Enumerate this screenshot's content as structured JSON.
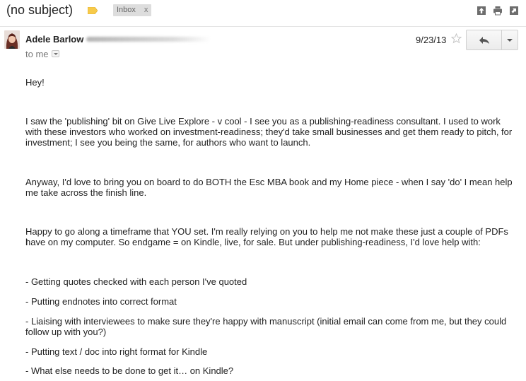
{
  "header": {
    "subject": "(no subject)",
    "label_chip": "Inbox",
    "label_chip_remove": "x",
    "icons": [
      "archive-icon",
      "print-icon",
      "new-window-icon"
    ],
    "label_tag_color": "#f7ca4a"
  },
  "message": {
    "sender_name": "Adele Barlow",
    "recipient_text": "to me",
    "date": "9/23/13"
  },
  "body": {
    "p1": "Hey!",
    "p2_line1": "I saw the 'publishing' bit on Give Live Explore - v cool - I see you as a publishing-readiness consultant. I used to work",
    "p2_line2": "with these investors who worked on investment-readiness; they'd take small businesses and get them ready to pitch, for",
    "p2_line3": "investment; I see you being the same, for authors who want to launch.",
    "p3_line1": "Anyway, I'd love to bring you on board to do BOTH the Esc MBA book and my Home piece - when I say 'do' I mean help",
    "p3_line2": "me take across the finish line.",
    "p4_line1": "Happy to go along a timeframe that YOU set. I'm really relying on you to help me not make these just a couple of PDFs I",
    "p4_line2": "have on my computer. So endgame = on Kindle, live, for sale. But under publishing-readiness, I'd love help with:",
    "item1": "- Getting quotes checked with each person I've quoted",
    "item2": "- Putting endnotes into correct format",
    "item3_line1": "- Liaising with interviewees to make sure they're happy with manuscript (initial email can come from me, but they could",
    "item3_line2": "follow up with you?)",
    "item4": "- Putting text / doc into right format for Kindle",
    "item5": "- What else needs to be done to get it… on Kindle?"
  }
}
